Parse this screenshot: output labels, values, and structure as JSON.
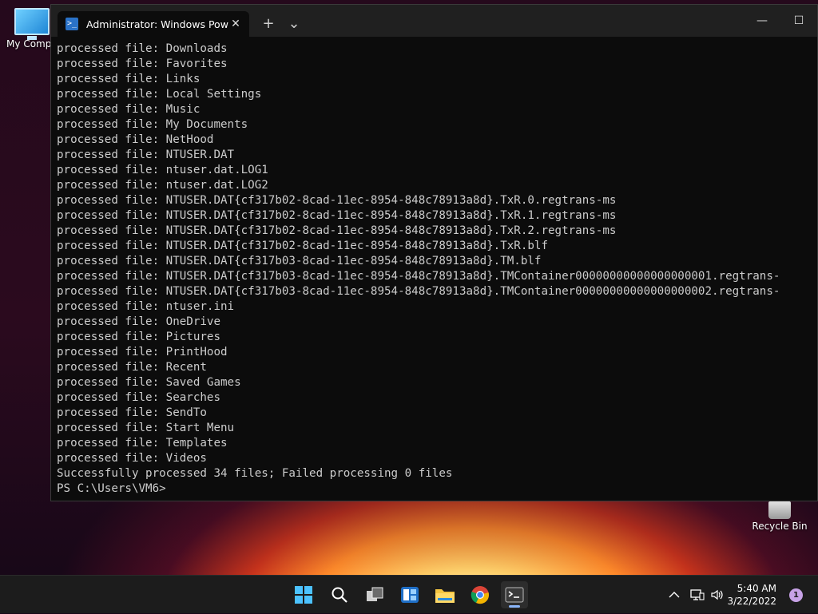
{
  "desktop": {
    "icons": [
      {
        "label": "My Compu",
        "name": "my-computer"
      },
      {
        "label": "Recycle Bin",
        "name": "recycle-bin"
      }
    ]
  },
  "window": {
    "tab_title": "Administrator: Windows PowerS",
    "new_tab": "+",
    "dropdown": "⌄",
    "tab_close": "✕",
    "minimize": "—",
    "maximize": "☐"
  },
  "console": {
    "lines": [
      "processed file: Downloads",
      "processed file: Favorites",
      "processed file: Links",
      "processed file: Local Settings",
      "processed file: Music",
      "processed file: My Documents",
      "processed file: NetHood",
      "processed file: NTUSER.DAT",
      "processed file: ntuser.dat.LOG1",
      "processed file: ntuser.dat.LOG2",
      "processed file: NTUSER.DAT{cf317b02-8cad-11ec-8954-848c78913a8d}.TxR.0.regtrans-ms",
      "processed file: NTUSER.DAT{cf317b02-8cad-11ec-8954-848c78913a8d}.TxR.1.regtrans-ms",
      "processed file: NTUSER.DAT{cf317b02-8cad-11ec-8954-848c78913a8d}.TxR.2.regtrans-ms",
      "processed file: NTUSER.DAT{cf317b02-8cad-11ec-8954-848c78913a8d}.TxR.blf",
      "processed file: NTUSER.DAT{cf317b03-8cad-11ec-8954-848c78913a8d}.TM.blf",
      "processed file: NTUSER.DAT{cf317b03-8cad-11ec-8954-848c78913a8d}.TMContainer00000000000000000001.regtrans-",
      "processed file: NTUSER.DAT{cf317b03-8cad-11ec-8954-848c78913a8d}.TMContainer00000000000000000002.regtrans-",
      "processed file: ntuser.ini",
      "processed file: OneDrive",
      "processed file: Pictures",
      "processed file: PrintHood",
      "processed file: Recent",
      "processed file: Saved Games",
      "processed file: Searches",
      "processed file: SendTo",
      "processed file: Start Menu",
      "processed file: Templates",
      "processed file: Videos",
      "Successfully processed 34 files; Failed processing 0 files",
      "PS C:\\Users\\VM6>"
    ]
  },
  "taskbar": {
    "apps": [
      "start",
      "search",
      "task-view",
      "widgets",
      "file-explorer",
      "chrome",
      "terminal"
    ],
    "time": "5:40 AM",
    "date": "3/22/2022",
    "notification_count": "1",
    "colors": {
      "accent": "#4cc2ff",
      "taskbar": "#1c1c1c",
      "console_bg": "#0c0c0c",
      "console_fg": "#cccccc"
    }
  }
}
